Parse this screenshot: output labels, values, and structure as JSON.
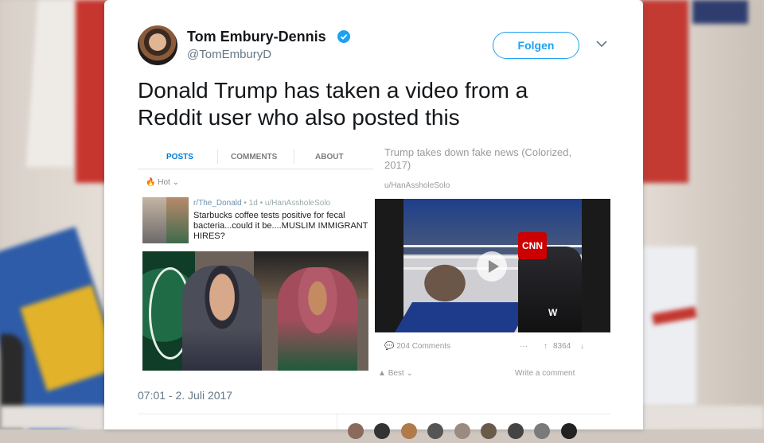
{
  "tweet": {
    "author_name": "Tom Embury-Dennis",
    "author_handle": "@TomEmburyD",
    "follow_label": "Folgen",
    "text": "Donald Trump has taken a video from a Reddit user who also posted this",
    "timestamp": "07:01 - 2. Juli 2017"
  },
  "left_screenshot": {
    "tabs": [
      "POSTS",
      "COMMENTS",
      "ABOUT"
    ],
    "sort_label": "Hot",
    "subreddit": "r/The_Donald",
    "meta": "1d",
    "user": "u/HanAssholeSolo",
    "post_title": "Starbucks coffee tests positive for fecal bacteria...could it be....MUSLIM IMMIGRANT HIRES?"
  },
  "right_screenshot": {
    "title": "Trump takes down fake news (Colorized, 2017)",
    "user": "u/HanAssholeSolo",
    "video_logo": "CNN",
    "video_brand": "W",
    "comments": "204 Comments",
    "more": "···",
    "score": "8364",
    "sort_label": "Best",
    "write_comment": "Write a comment"
  },
  "colors": {
    "accent": "#1da1f2",
    "reddit_active_tab": "#0079d3"
  }
}
